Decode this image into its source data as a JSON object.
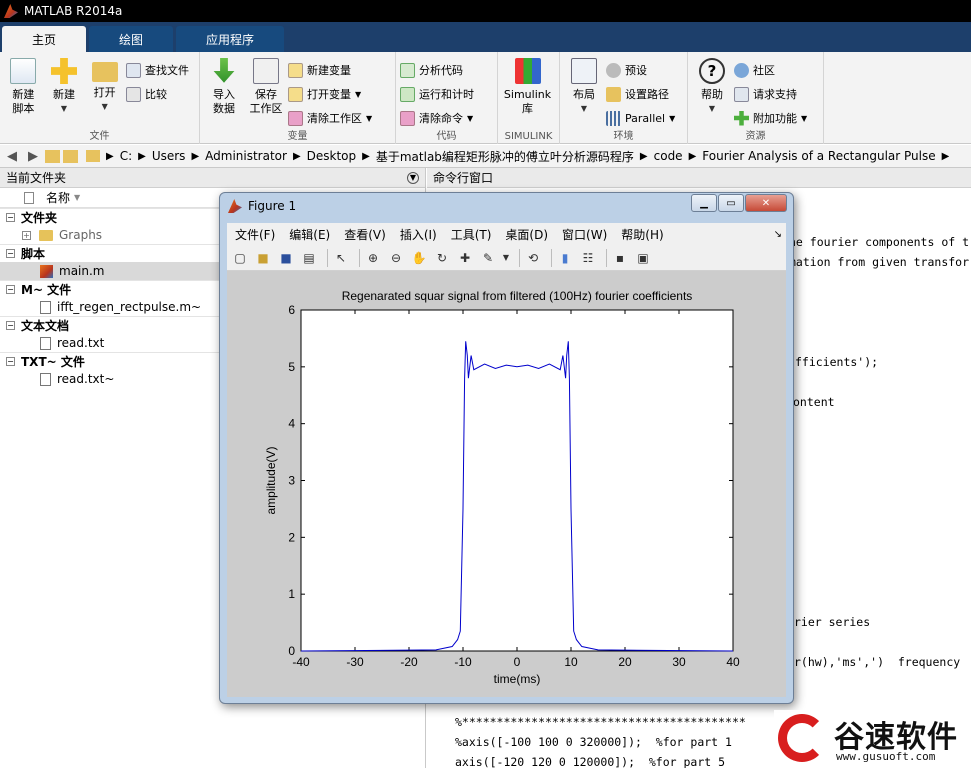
{
  "app": {
    "title": "MATLAB R2014a"
  },
  "tabs": [
    "主页",
    "绘图",
    "应用程序"
  ],
  "ribbon": {
    "file_group": {
      "label": "文件",
      "new_script": "新建\n脚本",
      "new": "新建",
      "open": "打开",
      "find_files": "查找文件",
      "compare": "比较"
    },
    "variable_group": {
      "label": "变量",
      "import": "导入\n数据",
      "save_ws": "保存\n工作区",
      "new_var": "新建变量",
      "open_var": "打开变量",
      "clear_ws": "清除工作区"
    },
    "code_group": {
      "label": "代码",
      "analyze": "分析代码",
      "run_time": "运行和计时",
      "clear_cmd": "清除命令"
    },
    "simulink_group": {
      "label": "SIMULINK",
      "simulink": "Simulink\n库"
    },
    "env_group": {
      "label": "环境",
      "layout": "布局",
      "prefs": "预设",
      "set_path": "设置路径",
      "parallel": "Parallel"
    },
    "resources_group": {
      "label": "资源",
      "help": "帮助",
      "community": "社区",
      "support": "请求支持",
      "addons": "附加功能"
    }
  },
  "address": {
    "crumbs": [
      "C:",
      "Users",
      "Administrator",
      "Desktop",
      "基于matlab编程矩形脉冲的傅立叶分析源码程序",
      "code",
      "Fourier Analysis of a Rectangular Pulse"
    ]
  },
  "left_panel": {
    "title": "当前文件夹",
    "name_col": "名称",
    "sections": [
      {
        "label": "文件夹",
        "items": [
          "Graphs"
        ]
      },
      {
        "label": "脚本",
        "items": [
          "main.m"
        ]
      },
      {
        "label": "M~ 文件",
        "items": [
          "ifft_regen_rectpulse.m~"
        ]
      },
      {
        "label": "文本文档",
        "items": [
          "read.txt"
        ]
      },
      {
        "label": "TXT~ 文件",
        "items": [
          "read.txt~"
        ]
      }
    ]
  },
  "command_window": {
    "title": "命令行窗口",
    "lines": [
      "he fourier components of t",
      "mation from given transfor",
      "fficients');",
      "ontent",
      "rier series",
      "r(hw),'ms',')  frequency",
      "%*****************************************",
      "%axis([-100 100 0 320000]);  %for part 1",
      "axis([-120 120 0 120000]);  %for part 5"
    ]
  },
  "figure": {
    "title": "Figure 1",
    "menus": [
      "文件(F)",
      "编辑(E)",
      "查看(V)",
      "插入(I)",
      "工具(T)",
      "桌面(D)",
      "窗口(W)",
      "帮助(H)"
    ]
  },
  "chart_data": {
    "type": "line",
    "title": "Regenarated squar signal from filtered (100Hz) fourier coefficients",
    "xlabel": "time(ms)",
    "ylabel": "amplitude(V)",
    "xlim": [
      -40,
      40
    ],
    "ylim": [
      0,
      6
    ],
    "xticks": [
      -40,
      -30,
      -20,
      -10,
      0,
      10,
      20,
      30,
      40
    ],
    "yticks": [
      0,
      1,
      2,
      3,
      4,
      5,
      6
    ],
    "series": [
      {
        "color": "#0000cc",
        "x": [
          -40,
          -15,
          -12,
          -11,
          -10.5,
          -10,
          -9.7,
          -9.5,
          -9.2,
          -9,
          -8.5,
          -8,
          -6,
          -4,
          -2,
          0,
          2,
          4,
          6,
          8,
          8.5,
          9,
          9.2,
          9.5,
          9.7,
          10,
          10.5,
          11,
          12,
          15,
          40
        ],
        "y": [
          0,
          0.02,
          0.08,
          0.2,
          0.35,
          2.5,
          4.8,
          5.45,
          5.2,
          4.8,
          5.2,
          4.95,
          5.05,
          4.97,
          5.03,
          5.0,
          5.03,
          4.97,
          5.05,
          4.95,
          5.2,
          4.8,
          5.2,
          5.45,
          4.8,
          2.5,
          0.35,
          0.2,
          0.08,
          0.02,
          0
        ]
      }
    ]
  },
  "watermark": {
    "text": "谷速软件",
    "url": "www.gusuoft.com"
  },
  "colors": {
    "ribbon_bg": "#f3f3f3",
    "tab_bar": "#1d3f6b",
    "plot_line": "#0000cc"
  }
}
